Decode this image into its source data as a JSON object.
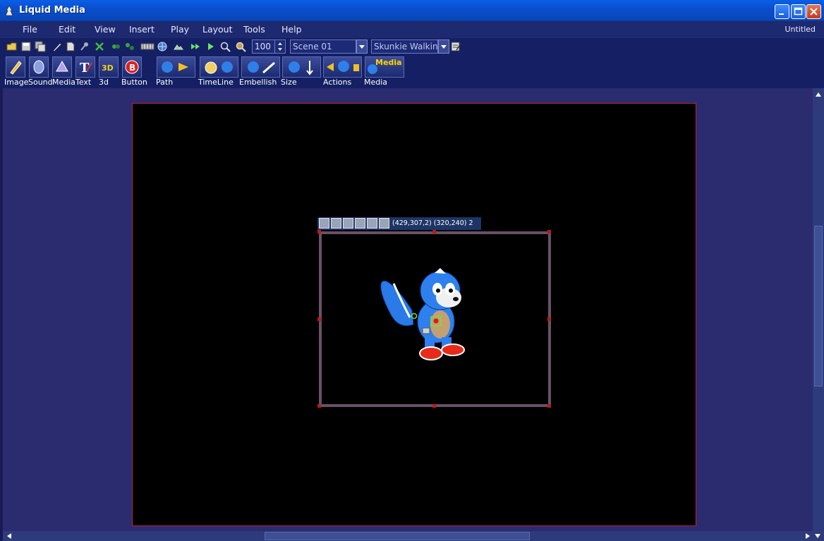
{
  "window": {
    "title": "Liquid Media",
    "document": "Untitled"
  },
  "menu": {
    "items": [
      "File",
      "Edit",
      "View",
      "Insert",
      "Play",
      "Layout",
      "Tools",
      "Help"
    ]
  },
  "toolbar": {
    "zoom_value": "100",
    "scene_value": "Scene 01",
    "object_value": "Skunkie Walking",
    "icons": [
      "open-icon",
      "save-icon",
      "save-all-icon",
      "pencil-icon",
      "page-icon",
      "pin-icon",
      "delete-icon",
      "group-icon",
      "ungroup-icon",
      "film-icon",
      "globe-icon",
      "image-icon",
      "fast-forward-icon",
      "play-icon",
      "zoom-in-icon",
      "zoom-out-icon"
    ]
  },
  "insert_toolbar": {
    "buttons": [
      {
        "label": "Image",
        "icon": "image-insert-icon"
      },
      {
        "label": "Sound",
        "icon": "sound-insert-icon"
      },
      {
        "label": "Media",
        "icon": "media-insert-icon"
      },
      {
        "label": "Text",
        "icon": "text-insert-icon"
      },
      {
        "label": "3d",
        "icon": "3d-insert-icon"
      },
      {
        "label": "Button",
        "icon": "button-insert-icon"
      },
      {
        "label": "Path",
        "icon": "path-icon"
      },
      {
        "label": "TimeLine",
        "icon": "timeline-icon"
      },
      {
        "label": "Embellish",
        "icon": "embellish-icon"
      },
      {
        "label": "Size",
        "icon": "size-icon"
      },
      {
        "label": "Actions",
        "icon": "actions-icon"
      },
      {
        "label": "Media",
        "icon": "media-library-icon"
      }
    ],
    "media_badge": "Media"
  },
  "stage": {
    "object_info": "(429,307,2) (320,240)  2",
    "colors": {
      "stage_border": "#c0203a",
      "selection_frame": "#6a5068",
      "workspace_bg": "#2b2b70"
    }
  }
}
